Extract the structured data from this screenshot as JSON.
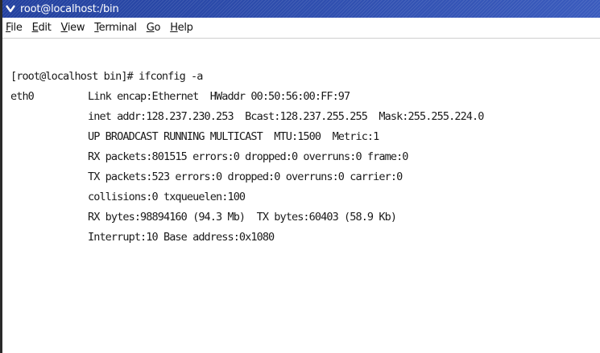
{
  "window": {
    "title": "root@localhost:/bin",
    "icon": "chevron-down-icon"
  },
  "menubar": {
    "items": [
      {
        "label": "File"
      },
      {
        "label": "Edit"
      },
      {
        "label": "View"
      },
      {
        "label": "Terminal"
      },
      {
        "label": "Go"
      },
      {
        "label": "Help"
      }
    ]
  },
  "terminal": {
    "prompt_line": "[root@localhost bin]# ifconfig -a",
    "interface_name": "eth0",
    "details": [
      "Link encap:Ethernet  HWaddr 00:50:56:00:FF:97",
      "inet addr:128.237.230.253  Bcast:128.237.255.255  Mask:255.255.224.0",
      "UP BROADCAST RUNNING MULTICAST  MTU:1500  Metric:1",
      "RX packets:801515 errors:0 dropped:0 overruns:0 frame:0",
      "TX packets:523 errors:0 dropped:0 overruns:0 carrier:0",
      "collisions:0 txqueuelen:100",
      "RX bytes:98894160 (94.3 Mb)  TX bytes:60403 (58.9 Kb)",
      "Interrupt:10 Base address:0x1080"
    ]
  },
  "colors": {
    "titlebar": "#2b49a8",
    "background": "#ffffff",
    "text": "#1a1a1a"
  }
}
